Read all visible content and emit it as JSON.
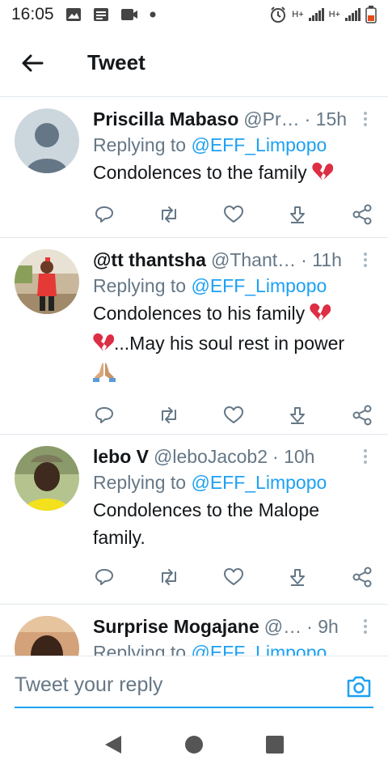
{
  "status_bar": {
    "time": "16:05",
    "net1": "H+",
    "net2": "H+"
  },
  "header": {
    "title": "Tweet"
  },
  "tweets": [
    {
      "name": "Priscilla Mabaso",
      "handle": "@Pr…",
      "time": "· 15h",
      "replying_prefix": "Replying to ",
      "replying_to": "@EFF_Limpopo",
      "text": "Condolences to the family",
      "emoji": "broken-heart-icon"
    },
    {
      "name": "@tt thantsha",
      "handle": "@Thant…",
      "time": "· 11h",
      "replying_prefix": "Replying to ",
      "replying_to": "@EFF_Limpopo",
      "text_line1": "Condolences to his family",
      "text_line2": "...May his soul rest in power",
      "emoji": "broken-heart-icon"
    },
    {
      "name": "lebo V",
      "handle": "@leboJacob2",
      "time": "· 10h",
      "replying_prefix": "Replying to ",
      "replying_to": "@EFF_Limpopo",
      "text": "Condolences to the Malope family."
    },
    {
      "name": "Surprise Mogajane",
      "handle": "@…",
      "time": "· 9h",
      "replying_prefix": "Replying to ",
      "replying_to": "@EFF_Limpopo"
    }
  ],
  "reply_bar": {
    "placeholder": "Tweet your reply"
  },
  "colors": {
    "accent": "#1da1f2",
    "secondary_text": "#657786",
    "broken_heart": "#dd2e44"
  }
}
